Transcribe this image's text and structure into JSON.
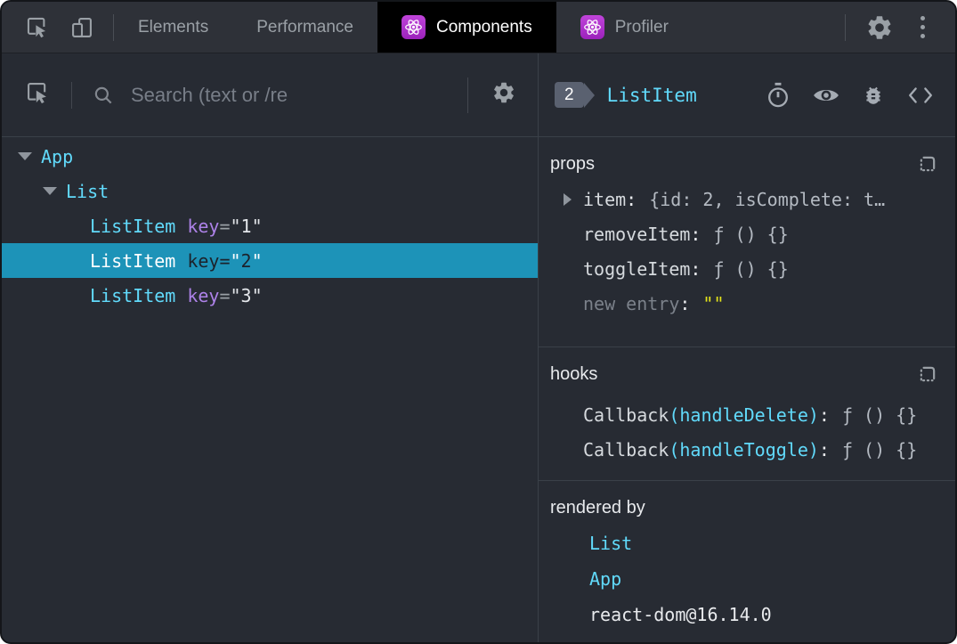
{
  "tokens": {
    "eq": "=",
    "quote": "\"",
    "colon": ":"
  },
  "topbar": {
    "tabs": [
      {
        "label": "Elements",
        "active": false
      },
      {
        "label": "Performance",
        "active": false
      },
      {
        "label": "Components",
        "active": true
      },
      {
        "label": "Profiler",
        "active": false
      }
    ]
  },
  "left": {
    "search": {
      "placeholder": "Search (text or /re"
    },
    "tree": [
      {
        "name": "App"
      },
      {
        "name": "List"
      },
      {
        "name": "ListItem",
        "attr": "key",
        "value": "1"
      },
      {
        "name": "ListItem",
        "attr": "key",
        "value": "2",
        "selected": true
      },
      {
        "name": "ListItem",
        "attr": "key",
        "value": "3"
      }
    ]
  },
  "right": {
    "header": {
      "badge": "2",
      "title": "ListItem"
    },
    "props": {
      "label": "props",
      "rows": [
        {
          "name": "item",
          "value": "{id: 2, isComplete: t…"
        },
        {
          "name": "removeItem",
          "value": "ƒ () {}"
        },
        {
          "name": "toggleItem",
          "value": "ƒ () {}"
        },
        {
          "name": "new entry",
          "value": "\"\""
        }
      ]
    },
    "hooks": {
      "label": "hooks",
      "rows": [
        {
          "prefix": "Callback",
          "target": "(handleDelete)",
          "value": "ƒ () {}"
        },
        {
          "prefix": "Callback",
          "target": "(handleToggle)",
          "value": "ƒ () {}"
        }
      ]
    },
    "rendered_by": {
      "label": "rendered by",
      "rows": [
        {
          "text": "List"
        },
        {
          "text": "App"
        },
        {
          "text": "react-dom@16.14.0"
        }
      ]
    }
  },
  "colors": {
    "accent_cyan": "#61dafb",
    "selected_row": "#1d93b8",
    "react_badge_purple": "#a32cc4",
    "attr_purple": "#ad82e8",
    "string_yellow": "#e3e31a",
    "active_tab_bg": "#000000"
  }
}
